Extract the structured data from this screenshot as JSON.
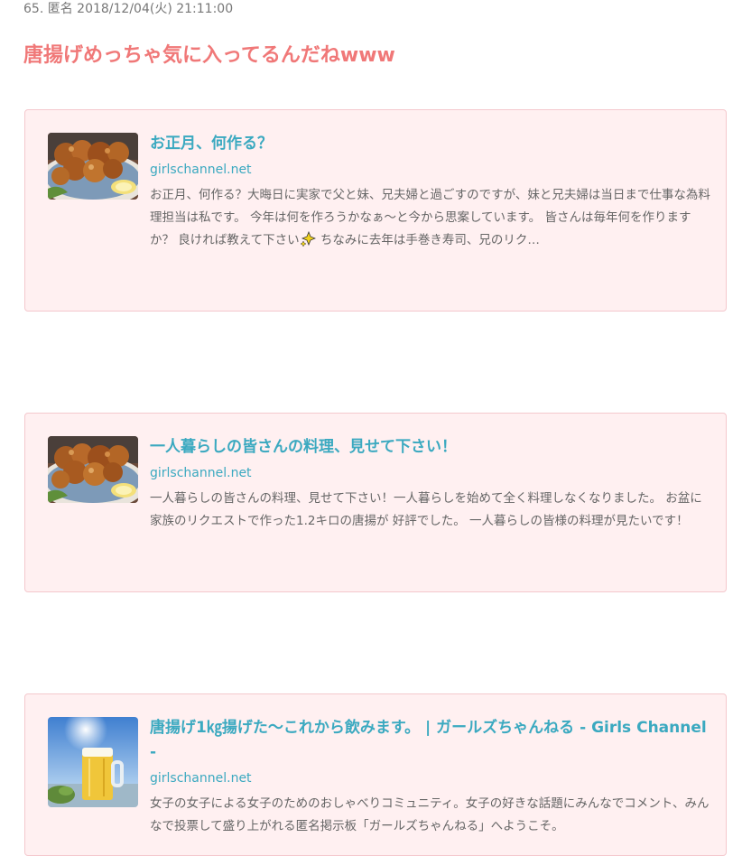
{
  "post": {
    "meta": "65. 匿名 2018/12/04(火) 21:11:00",
    "comment": "唐揚げめっちゃ気に入ってるんだねwww"
  },
  "cards": [
    {
      "title": "お正月、何作る？",
      "domain": "girlschannel.net",
      "description_before_icon": "お正月、何作る？大晦日に実家で父と妹、兄夫婦と過ごすのですが、妹と兄夫婦は当日まで仕事な為料理担当は私です。 今年は何を作ろうかなぁ～と今から思案しています。 皆さんは毎年何を作りますか？ 良ければ教えて下さい",
      "inline_icon": "sparkle-emoji",
      "description_after_icon": " ちなみに去年は手巻き寿司、兄のリク…",
      "thumbnail": "fried-chicken-photo"
    },
    {
      "title": "一人暮らしの皆さんの料理、見せて下さい！",
      "domain": "girlschannel.net",
      "description": "一人暮らしの皆さんの料理、見せて下さい！一人暮らしを始めて全く料理しなくなりました。 お盆に家族のリクエストで作った1.2キロの唐揚が 好評でした。 一人暮らしの皆様の料理が見たいです！",
      "thumbnail": "fried-chicken-photo"
    },
    {
      "title": "唐揚げ1㎏揚げた～これから飲みます。 | ガールズちゃんねる - Girls Channel -",
      "domain": "girlschannel.net",
      "description": "女子の女子による女子のためのおしゃべりコミュニティ。女子の好きな話題にみんなでコメント、みんなで投票して盛り上がれる匿名掲示板「ガールズちゃんねる」へようこそ。",
      "thumbnail": "beer-mug-photo"
    }
  ],
  "colors": {
    "comment": "#f07878",
    "card_bg": "#fff0f1",
    "card_border": "#f4c8cd",
    "link": "#3ba9c0",
    "meta": "#777777",
    "description": "#666666"
  }
}
